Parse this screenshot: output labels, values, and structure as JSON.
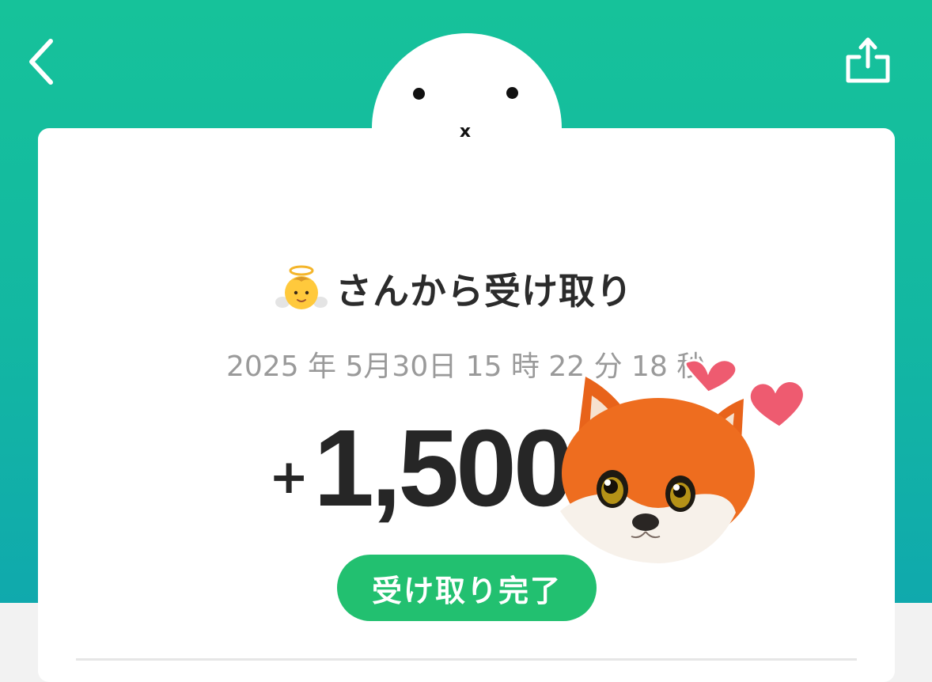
{
  "colors": {
    "header_green": "#16c29a",
    "header_teal": "#10a9ad",
    "badge_green": "#22c070",
    "text_dark": "#2b2b2b",
    "text_gray": "#9a9a9a"
  },
  "nav": {
    "back_icon": "chevron-left-icon",
    "share_icon": "share-icon"
  },
  "mascot": {
    "mouth": "x"
  },
  "transaction": {
    "sender_emoji": "👼",
    "title": "さんから受け取り",
    "datetime": "2025 年 5月30日 15 時 22 分 18 秒",
    "amount_sign": "+",
    "amount": "1,500",
    "status": "受け取り完了"
  },
  "sticker": {
    "icon": "fox-with-hearts-sticker"
  }
}
